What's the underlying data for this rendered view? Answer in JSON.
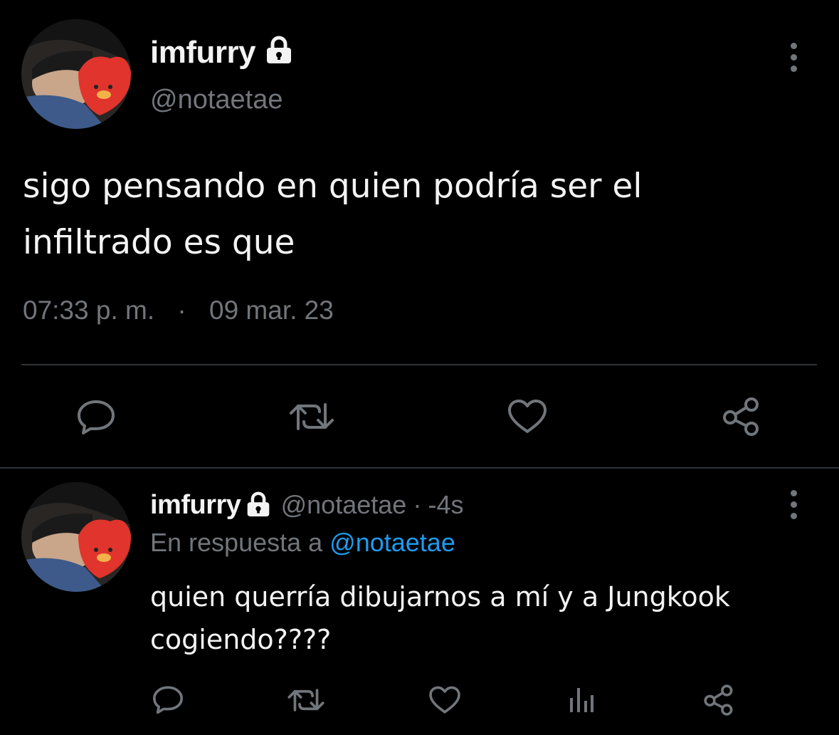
{
  "tweet": {
    "display_name": "imfurry",
    "handle": "@notaetae",
    "text": "sigo pensando en quien podría ser el infiltrado es que",
    "time": "07:33 p. m.",
    "separator": "·",
    "date": "09 mar. 23",
    "actions": [
      "reply-icon",
      "retweet-icon",
      "like-icon",
      "share-icon"
    ]
  },
  "reply": {
    "display_name": "imfurry",
    "handle": "@notaetae",
    "dot": "·",
    "age": "-4s",
    "in_reply_prefix": "En respuesta a",
    "in_reply_handle": "@notaetae",
    "text": "quien querría dibujarnos a mí y a Jungkook cogiendo????",
    "actions": [
      "reply-icon",
      "retweet-icon",
      "like-icon",
      "analytics-icon",
      "share-icon"
    ]
  },
  "colors": {
    "background": "#000000",
    "text": "#e7e9ea",
    "muted": "#71767b",
    "accent": "#1d9bf0",
    "divider": "#2f3336"
  }
}
